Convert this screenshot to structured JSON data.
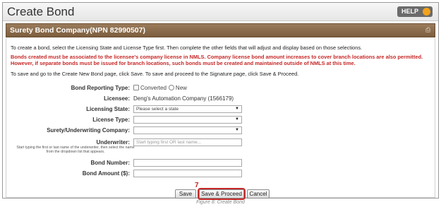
{
  "header": {
    "title": "Create Bond",
    "help_label": "HELP"
  },
  "section": {
    "title": "Surety Bond Company(NPN 82990507)"
  },
  "instructions": {
    "line1": "To create a bond, select the Licensing State and License Type first. Then complete the other fields that will adjust and display based on those selections.",
    "warning": "Bonds created must be associated to the licensee's company license in NMLS. Company license bond amount increases to cover branch locations are also permitted. However, if separate bonds must be issued for branch locations, such bonds must be created and maintained outside of NMLS at this time.",
    "line3": "To save and go to the Create New Bond page, click Save. To save and proceed to the Signature page, click Save & Proceed."
  },
  "form": {
    "reporting_type_label": "Bond Reporting Type:",
    "reporting_options": [
      "Converted",
      "New"
    ],
    "licensee_label": "Licensee:",
    "licensee_value": "Deng's Automation Company (1566179)",
    "licensing_state_label": "Licensing State:",
    "licensing_state_value": "Please select a state",
    "license_type_label": "License Type:",
    "license_type_value": "",
    "surety_label": "Surety/Underwriting Company:",
    "surety_value": "",
    "underwriter_label": "Underwriter:",
    "underwriter_placeholder": "Start typing first OR last name...",
    "underwriter_hint": "Start typing the first or last name of the underwriter, then select the name from the dropdown list that appears.",
    "bond_number_label": "Bond Number:",
    "bond_number_value": "",
    "bond_amount_label": "Bond Amount ($):",
    "bond_amount_value": ""
  },
  "buttons": {
    "save": "Save",
    "save_proceed": "Save & Proceed",
    "cancel": "Cancel"
  },
  "annotation": {
    "step_number": "7"
  },
  "caption": "Figure 8: Create Bond",
  "colors": {
    "section_header": "#8a6b4b",
    "warning_text": "#c62828",
    "help_accent": "#f3a21b"
  }
}
